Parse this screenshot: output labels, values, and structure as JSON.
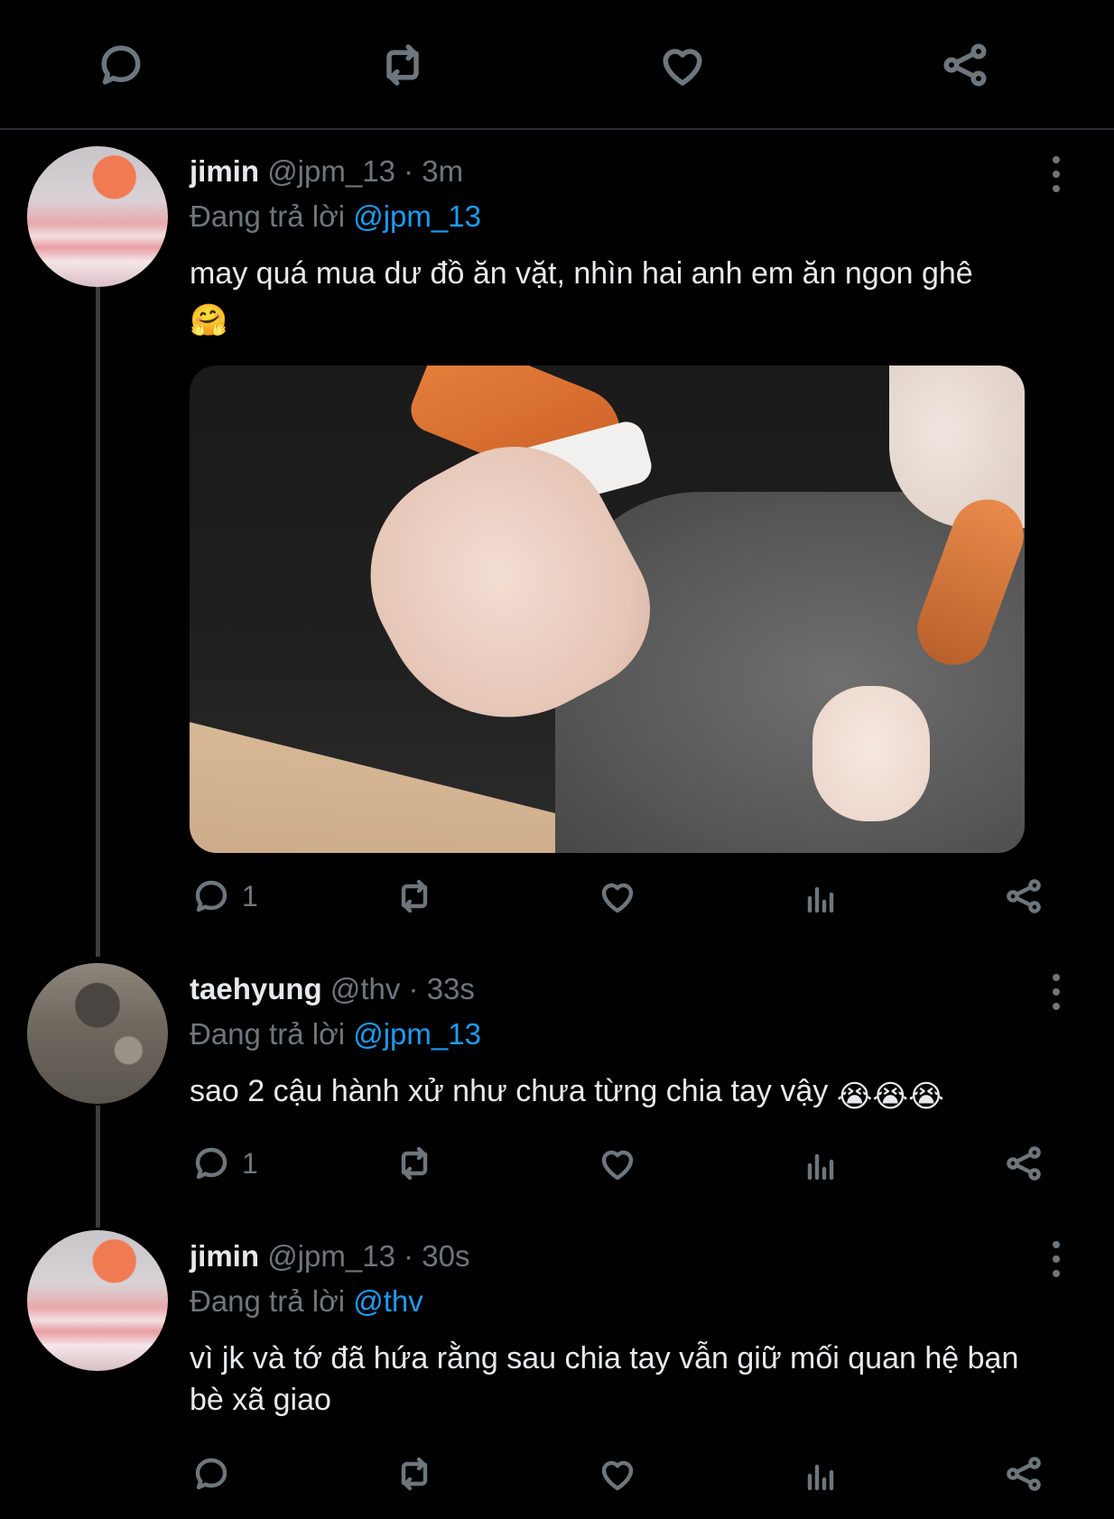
{
  "top_actions": {
    "reply_icon": "reply-icon",
    "retweet_icon": "retweet-icon",
    "like_icon": "like-icon",
    "share_icon": "share-icon"
  },
  "colors": {
    "background": "#000000",
    "text": "#e7e9ea",
    "muted": "#6e767d",
    "link": "#1d9bf0"
  },
  "tweets": [
    {
      "name": "jimin",
      "handle": "@jpm_13 · 3m",
      "reply_prefix": "Đang trả lời",
      "reply_mention": "@jpm_13",
      "text": "may quá mua dư đồ ăn vặt, nhìn hai anh em ăn ngon ghê",
      "emoji": "🤗",
      "has_media": true,
      "reply_count": "1"
    },
    {
      "name": "taehyung",
      "handle": "@thv · 33s",
      "reply_prefix": "Đang trả lời",
      "reply_mention": "@jpm_13",
      "text": "sao 2 cậu hành xử như chưa từng chia tay vậy",
      "emoji": "😭😭😭",
      "reply_count": "1"
    },
    {
      "name": "jimin",
      "handle": "@jpm_13 · 30s",
      "reply_prefix": "Đang trả lời",
      "reply_mention": "@thv",
      "text": "vì jk và tớ đã hứa rằng sau chia tay vẫn giữ mối quan hệ bạn bè xã giao",
      "reply_count": ""
    }
  ]
}
